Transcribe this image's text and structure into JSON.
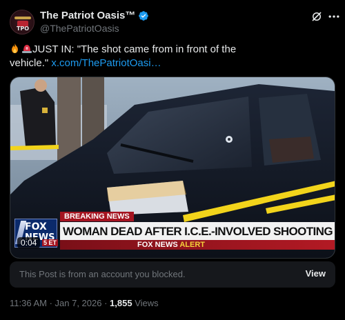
{
  "author": {
    "display_name": "The Patriot Oasis™",
    "handle": "@ThePatriotOasis",
    "avatar_text": "TPO"
  },
  "tweet": {
    "text_prefix": "JUST IN:  \"The shot came from in front of the vehicle.\"",
    "link_text": "x.com/ThePatriotOasi…",
    "emojis": [
      "fire-emoji",
      "siren-emoji"
    ]
  },
  "media": {
    "breaking_label": "BREAKING NEWS",
    "headline": "WOMAN DEAD AFTER I.C.E.-INVOLVED SHOOTING IN MN",
    "logo_line1": "FOX",
    "logo_line2": "NEWS",
    "alert_brand": "FOX NEWS",
    "alert_word": "ALERT",
    "duration": "0:04",
    "timezone_badge": "5 ET"
  },
  "blocked": {
    "message": "This Post is from an account you blocked.",
    "view_label": "View"
  },
  "meta": {
    "time": "11:36 AM",
    "date": "Jan 7, 2026",
    "view_count": "1,855",
    "views_label": "Views"
  },
  "colors": {
    "link": "#1d9bf0",
    "verified": "#1d9bf0",
    "breaking_red": "#a41420"
  }
}
